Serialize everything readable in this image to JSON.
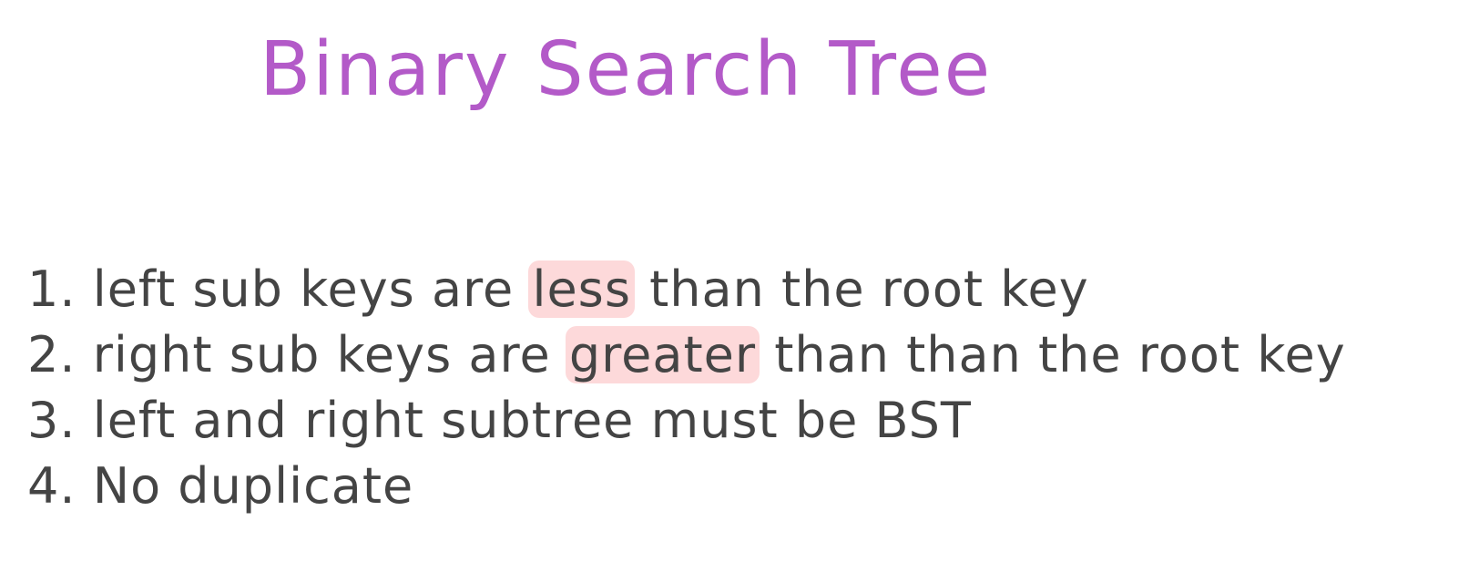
{
  "title": "Binary Search Tree",
  "colors": {
    "title": "#b35ac8",
    "text": "#444444",
    "highlight": "#fdd9da",
    "background": "#ffffff"
  },
  "rules": [
    {
      "number": "1.",
      "before": "left sub keys are ",
      "highlight": "less",
      "after": " than the root key"
    },
    {
      "number": "2.",
      "before": "right sub keys are ",
      "highlight": "greater",
      "after": " than than the root key"
    },
    {
      "number": "3.",
      "text": "left and right subtree must be BST"
    },
    {
      "number": "4.",
      "text": "No duplicate"
    }
  ]
}
